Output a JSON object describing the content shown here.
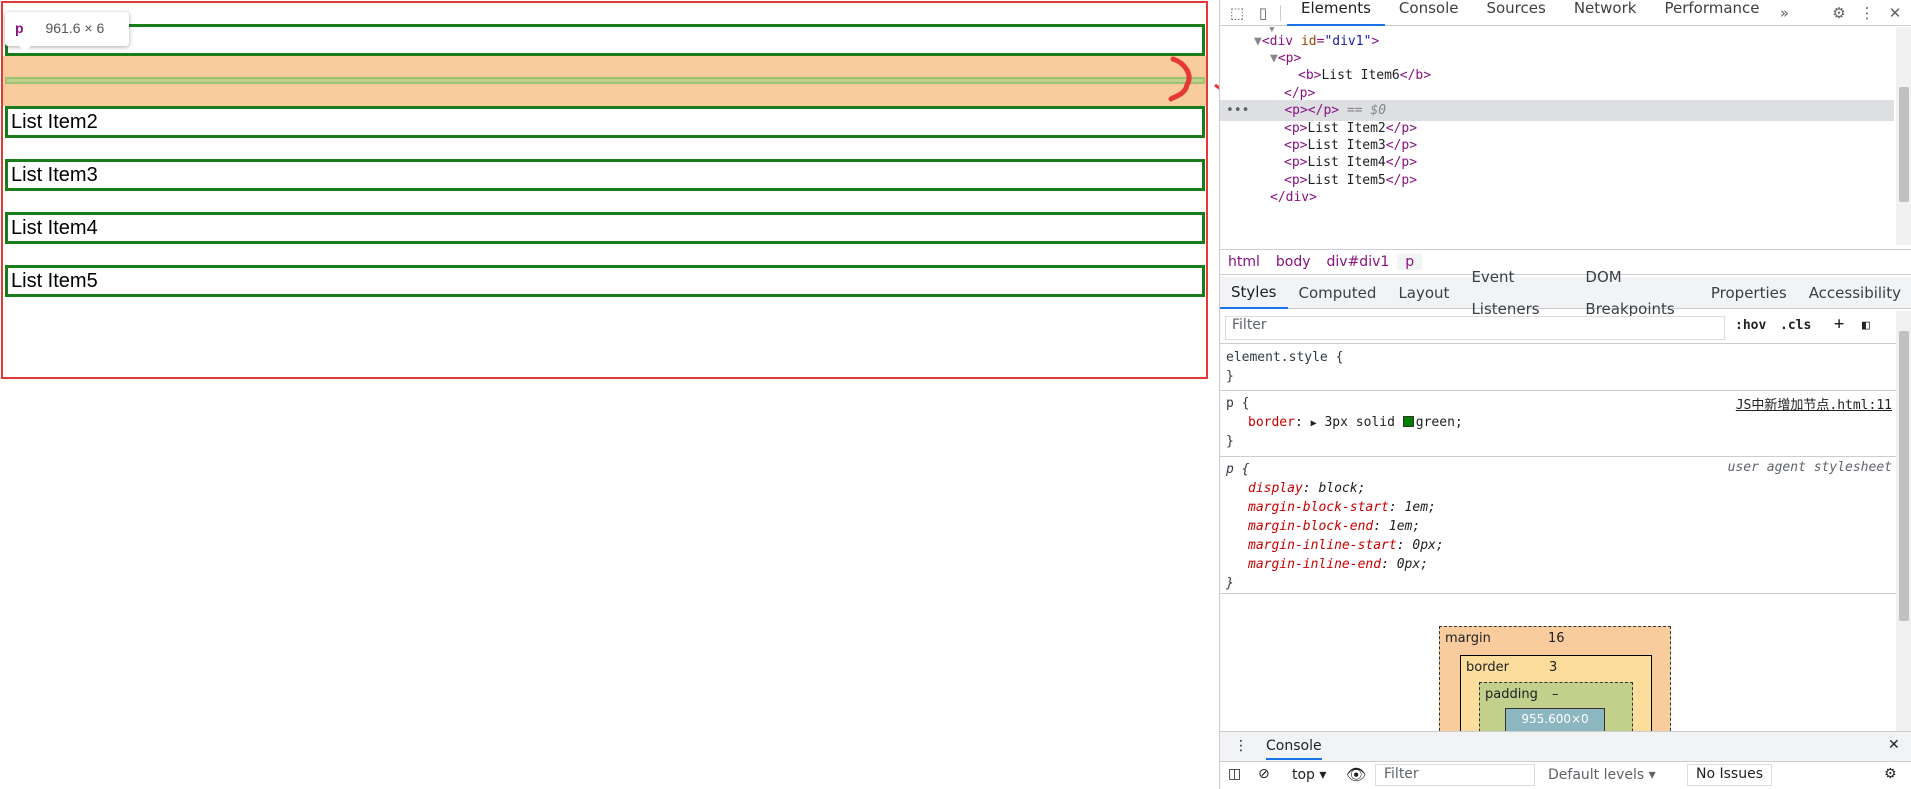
{
  "page": {
    "items": [
      "List Item6",
      "List Item2",
      "List Item3",
      "List Item4",
      "List Item5"
    ],
    "tooltip": {
      "tag": "p",
      "size": "961.6 × 6"
    }
  },
  "devtools": {
    "top_tabs": [
      "Elements",
      "Console",
      "Sources",
      "Network",
      "Performance"
    ],
    "active_top_tab": "Elements",
    "dom": {
      "div_open_tag": "div",
      "div_attr_name": "id",
      "div_attr_value": "\"div1\"",
      "p_tag": "p",
      "b_tag": "b",
      "b_text": "List Item6",
      "selected_suffix": "== $0",
      "items": [
        "List Item2",
        "List Item3",
        "List Item4",
        "List Item5"
      ]
    },
    "breadcrumbs": [
      "html",
      "body",
      "div#div1",
      "p"
    ],
    "side_tabs": [
      "Styles",
      "Computed",
      "Layout",
      "Event Listeners",
      "DOM Breakpoints",
      "Properties",
      "Accessibility"
    ],
    "filter_placeholder": "Filter",
    "hov_label": ":hov",
    "cls_label": ".cls",
    "rules": {
      "element_style": "element.style {",
      "p_selector": "p {",
      "p_source": "JS中新增加节点.html:11",
      "border_prop": "border",
      "border_value": "3px solid",
      "border_color_name": "green",
      "border_color": "#008000",
      "ua_source": "user agent stylesheet",
      "ua_props": [
        {
          "name": "display",
          "value": "block;"
        },
        {
          "name": "margin-block-start",
          "value": "1em;"
        },
        {
          "name": "margin-block-end",
          "value": "1em;"
        },
        {
          "name": "margin-inline-start",
          "value": "0px;"
        },
        {
          "name": "margin-inline-end",
          "value": "0px;"
        }
      ],
      "close_brace": "}"
    },
    "box_model": {
      "margin_label": "margin",
      "margin_value": "16",
      "border_label": "border",
      "border_value": "3",
      "padding_label": "padding",
      "padding_value": "–",
      "content": "955.600×0",
      "side": "3"
    },
    "drawer": {
      "tab": "Console",
      "context": "top",
      "filter_placeholder": "Filter",
      "levels": "Default levels",
      "issues": "No Issues"
    }
  },
  "colors": {
    "highlight_margin": "#f9cc9d",
    "item_border": "#1a7d1a",
    "container_border": "#e53935",
    "accent": "#1a73e8"
  }
}
